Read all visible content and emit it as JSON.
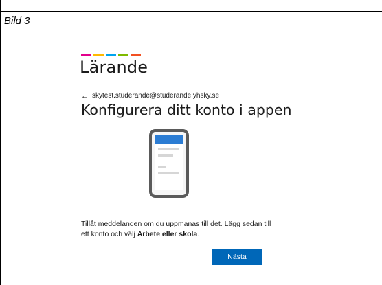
{
  "document": {
    "caption": "Bild 3"
  },
  "screenshot": {
    "brand": {
      "name": "Lärande",
      "bar_colors": [
        "#e3008c",
        "#ffb900",
        "#00a4ef",
        "#7fba00",
        "#f25022"
      ]
    },
    "back": {
      "icon": "arrow-left-icon",
      "account": "skytest.studerande@studerande.yhsky.se"
    },
    "heading": "Konfigurera ditt konto i appen",
    "illustration": {
      "icon": "phone-icon",
      "accent_color": "#2b7cd3"
    },
    "body": {
      "text_before": "Tillåt meddelanden om du uppmanas till det. Lägg sedan till ett konto och välj ",
      "bold": "Arbete eller skola",
      "text_after": "."
    },
    "next_button": {
      "label": "Nästa",
      "color": "#0067b8"
    }
  }
}
